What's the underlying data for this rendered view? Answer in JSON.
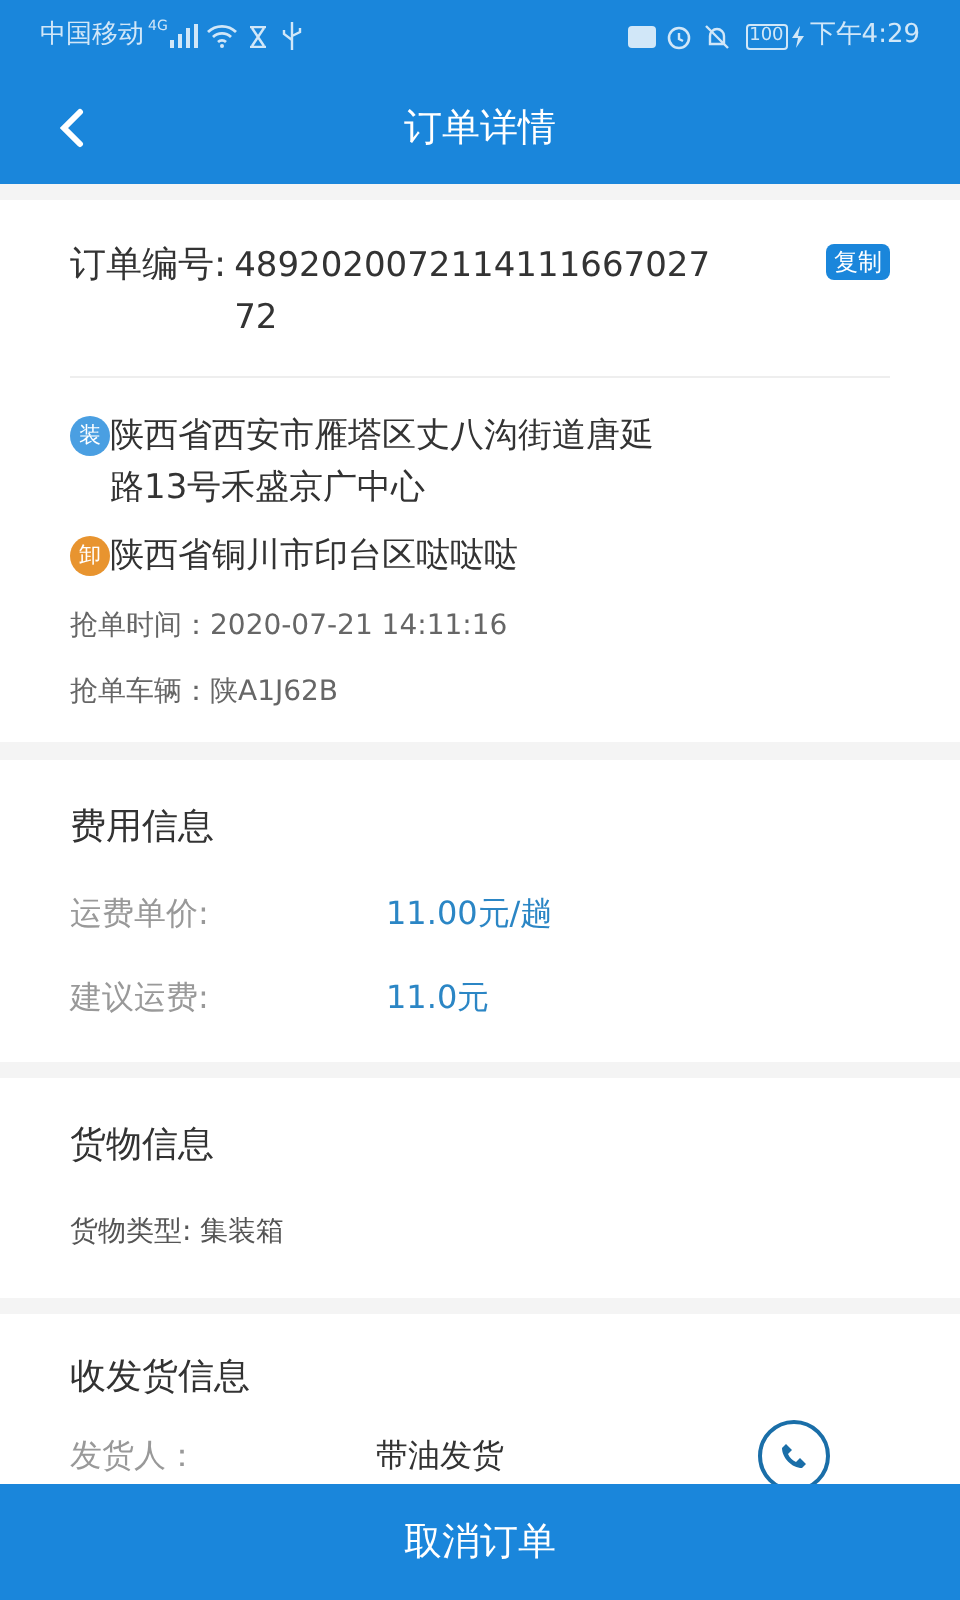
{
  "status_bar": {
    "carrier": "中国移动",
    "network": "4G",
    "battery": "100",
    "time": "下午4:29"
  },
  "header": {
    "title": "订单详情"
  },
  "order": {
    "number_label": "订单编号:",
    "number": "489202007211411166702772",
    "copy_button": "复制",
    "stops": [
      {
        "kind": "load",
        "badge": "装",
        "address": "陕西省西安市雁塔区丈八沟街道唐延路13号禾盛京广中心"
      },
      {
        "kind": "unload",
        "badge": "卸",
        "address": "陕西省铜川市印台区哒哒哒"
      }
    ],
    "grab_time": "抢单时间：2020-07-21 14:11:16",
    "vehicle": "抢单车辆：陕A1J62B"
  },
  "fees": {
    "title": "费用信息",
    "rows": [
      {
        "label": "运费单价:",
        "value": "11.00元/趟"
      },
      {
        "label": "建议运费:",
        "value": "11.0元"
      }
    ]
  },
  "cargo": {
    "title": "货物信息",
    "type": "货物类型: 集装箱"
  },
  "shipping": {
    "title": "收发货信息",
    "rows": [
      {
        "label": "发货人：",
        "value": "带油发货"
      }
    ]
  },
  "cancel_button": "取消订单"
}
